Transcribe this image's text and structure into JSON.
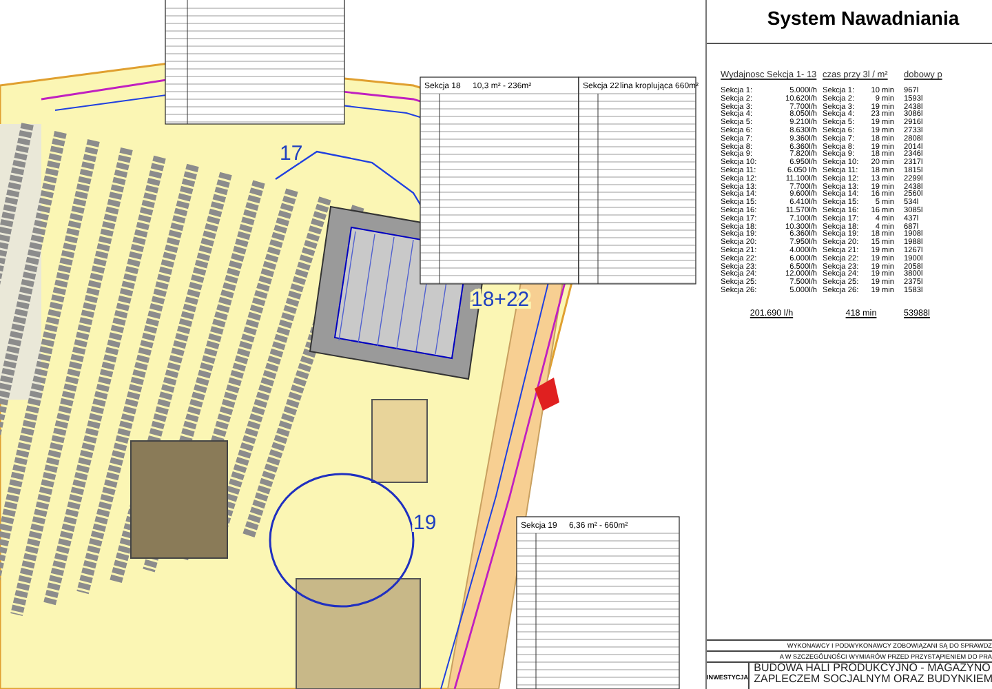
{
  "site_plan": {
    "section_labels": [
      "17",
      "18+22",
      "19"
    ],
    "tables": [
      {
        "title": "Sekcja 18",
        "subtitle": "10,3 m² - 236m²"
      },
      {
        "title": "Sekcja 22",
        "subtitle": "lina kroplująca 660m²"
      },
      {
        "title": "Sekcja 19",
        "subtitle": "6,36 m² - 660m²"
      }
    ]
  },
  "panel": {
    "title": "System Nawadniania",
    "headers": [
      "Wydajnosc Sekcja 1- 13",
      "czas przy 3l / m²",
      "dobowy p"
    ],
    "rows": [
      {
        "label": "Sekcja 1:",
        "flow": "5.000l/h",
        "time_label": "Sekcja 1:",
        "time": "10 min",
        "daily": "967l"
      },
      {
        "label": "Sekcja 2:",
        "flow": "10.620l/h",
        "time_label": "Sekcja 2:",
        "time": "9 min",
        "daily": "1593l"
      },
      {
        "label": "Sekcja 3:",
        "flow": "7.700l/h",
        "time_label": "Sekcja 3:",
        "time": "19 min",
        "daily": "2438l"
      },
      {
        "label": "Sekcja 4:",
        "flow": "8.050l/h",
        "time_label": "Sekcja 4:",
        "time": "23 min",
        "daily": "3086l"
      },
      {
        "label": "Sekcja 5:",
        "flow": "9.210l/h",
        "time_label": "Sekcja 5:",
        "time": "19 min",
        "daily": "2916l"
      },
      {
        "label": "Sekcja 6:",
        "flow": "8.630l/h",
        "time_label": "Sekcja 6:",
        "time": "19 min",
        "daily": "2733l"
      },
      {
        "label": "Sekcja 7:",
        "flow": "9.360l/h",
        "time_label": "Sekcja 7:",
        "time": "18 min",
        "daily": "2808l"
      },
      {
        "label": "Sekcja 8:",
        "flow": "6.360l/h",
        "time_label": "Sekcja 8:",
        "time": "19 min",
        "daily": "2014l"
      },
      {
        "label": "Sekcja 9:",
        "flow": "7.820l/h",
        "time_label": "Sekcja 9:",
        "time": "18 min",
        "daily": "2346l"
      },
      {
        "label": "Sekcja 10:",
        "flow": "6.950l/h",
        "time_label": "Sekcja 10:",
        "time": "20 min",
        "daily": "2317l"
      },
      {
        "label": "Sekcja 11:",
        "flow": "6.050 l/h",
        "time_label": "Sekcja 11:",
        "time": "18 min",
        "daily": "1815l"
      },
      {
        "label": "Sekcja 12:",
        "flow": "11.100l/h",
        "time_label": "Sekcja 12:",
        "time": "13 min",
        "daily": "2299l"
      },
      {
        "label": "Sekcja 13:",
        "flow": "7.700l/h",
        "time_label": "Sekcja 13:",
        "time": "19 min",
        "daily": "2438l"
      },
      {
        "label": "Sekcja 14:",
        "flow": "9.600l/h",
        "time_label": "Sekcja 14:",
        "time": "16 min",
        "daily": "2560l"
      },
      {
        "label": "Sekcja 15:",
        "flow": "6.410l/h",
        "time_label": "Sekcja 15:",
        "time": "5 min",
        "daily": "534l"
      },
      {
        "label": "Sekcja 16:",
        "flow": "11.570l/h",
        "time_label": "Sekcja 16:",
        "time": "16 min",
        "daily": "3085l"
      },
      {
        "label": "Sekcja 17:",
        "flow": "7.100l/h",
        "time_label": "Sekcja 17:",
        "time": "4 min",
        "daily": "437l"
      },
      {
        "label": "Sekcja 18:",
        "flow": "10.300l/h",
        "time_label": "Sekcja 18:",
        "time": "4 min",
        "daily": "687l"
      },
      {
        "label": "Sekcja 19:",
        "flow": "6.360l/h",
        "time_label": "Sekcja 19:",
        "time": "18 min",
        "daily": "1908l"
      },
      {
        "label": "Sekcja 20:",
        "flow": "7.950l/h",
        "time_label": "Sekcja 20:",
        "time": "15 min",
        "daily": "1988l"
      },
      {
        "label": "Sekcja 21:",
        "flow": "4.000l/h",
        "time_label": "Sekcja 21:",
        "time": "19 min",
        "daily": "1267l"
      },
      {
        "label": "Sekcja 22:",
        "flow": "6.000l/h",
        "time_label": "Sekcja 22:",
        "time": "19 min",
        "daily": "1900l"
      },
      {
        "label": "Sekcja 23:",
        "flow": "6.500l/h",
        "time_label": "Sekcja 23:",
        "time": "19 min",
        "daily": "2058l"
      },
      {
        "label": "Sekcja 24:",
        "flow": "12.000l/h",
        "time_label": "Sekcja 24:",
        "time": "19 min",
        "daily": "3800l"
      },
      {
        "label": "Sekcja 25:",
        "flow": "7.500l/h",
        "time_label": "Sekcja 25:",
        "time": "19 min",
        "daily": "2375l"
      },
      {
        "label": "Sekcja 26:",
        "flow": "5.000l/h",
        "time_label": "Sekcja 26:",
        "time": "19 min",
        "daily": "1583l"
      }
    ],
    "totals": [
      "201.690 l/h",
      "418 min",
      "53988l"
    ]
  },
  "title_block": {
    "notes": [
      "WYKONAWCY I PODWYKONAWCY ZOBOWIĄZANI SĄ DO SPRAWDZ",
      "A W SZCZEGÓLNOŚCI WYMIARÓW PRZED PRZYSTĄPIENIEM DO PRA"
    ],
    "label": "INWESTYCJA",
    "project": [
      "BUDOWA HALI PRODUKCYJNO - MAGAZYNO",
      "ZAPLECZEM SOCJALNYM ORAZ BUDYNKIEM"
    ]
  }
}
